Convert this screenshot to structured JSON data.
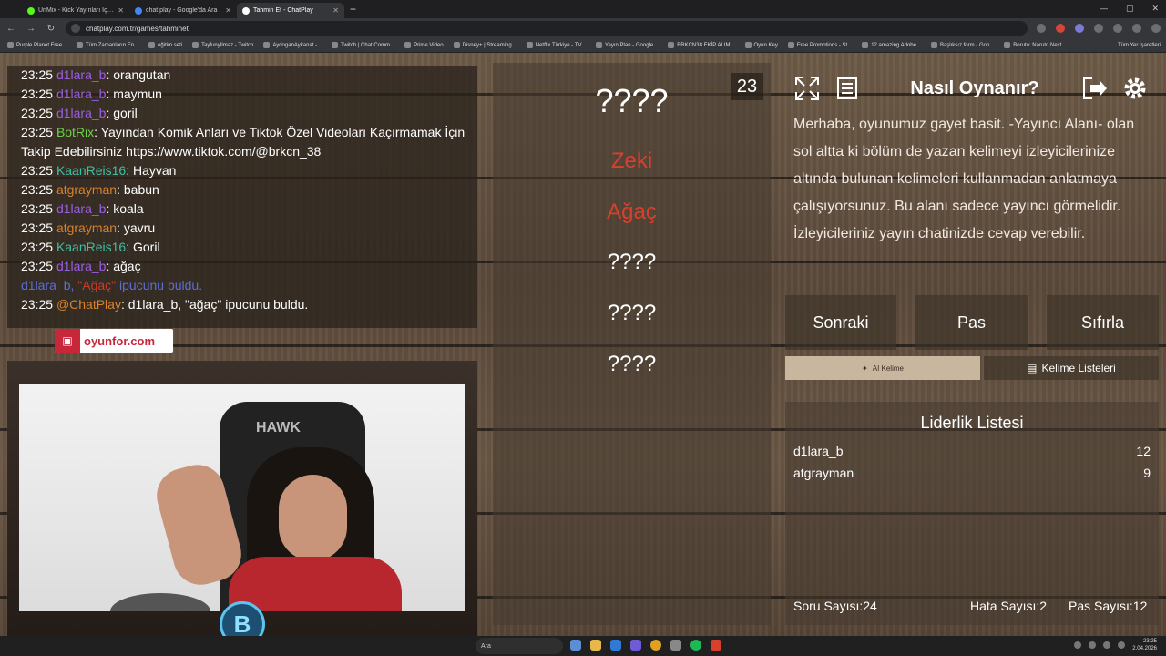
{
  "browser": {
    "tabs": [
      {
        "label": "UnMix - Kick Yayınları İçin Kelim",
        "favicon_color": "#53fc18"
      },
      {
        "label": "chat play - Google'da Ara",
        "favicon_color": "#4285f4"
      },
      {
        "label": "Tahmin Et - ChatPlay",
        "favicon_color": "#ffffff"
      }
    ],
    "url": "chatplay.com.tr/games/tahminet",
    "bookmarks": [
      "Purple Planet Free...",
      "Tüm Zamanların En...",
      "eğitim seti",
      "TayfunyIlmaz - Twitch",
      "AydoganAykanat -...",
      "Twitch | Chat Comm...",
      "Prime Video",
      "Disney+ | Streaming...",
      "Netflix Türkiye - TV...",
      "Yayın Plan - Google...",
      "BRKCN38 EKİP ALIM...",
      "Oyun Key",
      "Free Promotions - St...",
      "12 amazing Adobe...",
      "Başlıksız form - Goo...",
      "Boruto: Naruto Next..."
    ],
    "bookmarks_all": "Tüm Yer İşaretleri"
  },
  "chat": {
    "lines": [
      {
        "time": "23:25",
        "user": "d1lara_b",
        "user_color": "#9b5de5",
        "msg": "orangutan"
      },
      {
        "time": "23:25",
        "user": "d1lara_b",
        "user_color": "#9b5de5",
        "msg": "maymun"
      },
      {
        "time": "23:25",
        "user": "d1lara_b",
        "user_color": "#9b5de5",
        "msg": "goril"
      },
      {
        "time": "23:25",
        "user": "BotRix",
        "user_color": "#6ed04a",
        "msg": "Yayından Komik Anları ve Tiktok Özel Videoları Kaçırmamak İçin Takip Edebilirsiniz https://www.tiktok.com/@brkcn_38"
      },
      {
        "time": "23:25",
        "user": "KaanReis16",
        "user_color": "#3fbfa4",
        "msg": "Hayvan"
      },
      {
        "time": "23:25",
        "user": "atgrayman",
        "user_color": "#d9822b",
        "msg": "babun"
      },
      {
        "time": "23:25",
        "user": "d1lara_b",
        "user_color": "#9b5de5",
        "msg": "koala"
      },
      {
        "time": "23:25",
        "user": "atgrayman",
        "user_color": "#d9822b",
        "msg": "yavru"
      },
      {
        "time": "23:25",
        "user": "KaanReis16",
        "user_color": "#3fbfa4",
        "msg": "Goril"
      },
      {
        "time": "23:25",
        "user": "d1lara_b",
        "user_color": "#9b5de5",
        "msg": "ağaç"
      }
    ],
    "system": {
      "user": "d1lara_b,",
      "hint": "\"Ağaç\"",
      "rest": "ipucunu buldu."
    },
    "chatplay_line": {
      "time": "23:25",
      "user": "@ChatPlay",
      "msg": "d1lara_b, \"ağaç\" ipucunu buldu."
    },
    "brand_text": "oyunfor.com"
  },
  "cam": {
    "chair_text": "HAWK",
    "logo_text": "B"
  },
  "game": {
    "counter": "23",
    "main_word": "????",
    "revealed": [
      "Zeki",
      "Ağaç"
    ],
    "hidden": [
      "????",
      "????",
      "????"
    ]
  },
  "howto": {
    "title": "Nasıl Oynanır?",
    "text": "Merhaba, oyunumuz gayet basit. -Yayıncı Alanı- olan sol altta ki bölüm de yazan kelimeyi izleyicilerinize altında bulunan kelimeleri kullanmadan anlatmaya çalışıyorsunuz. Bu alanı sadece yayıncı görmelidir. İzleyicileriniz yayın chatinizde cevap verebilir."
  },
  "controls": {
    "next": "Sonraki",
    "pass": "Pas",
    "reset": "Sıfırla",
    "ai_word": "AI Kelime",
    "word_lists": "Kelime Listeleri"
  },
  "leaderboard": {
    "title": "Liderlik Listesi",
    "rows": [
      {
        "name": "d1lara_b",
        "score": "12"
      },
      {
        "name": "atgrayman",
        "score": "9"
      }
    ]
  },
  "stats": {
    "questions": "Soru Sayısı:24",
    "errors": "Hata Sayısı:2",
    "passes": "Pas Sayısı:12"
  },
  "taskbar": {
    "search": "Ara",
    "time": "23:25",
    "date": "2.04.2026"
  }
}
